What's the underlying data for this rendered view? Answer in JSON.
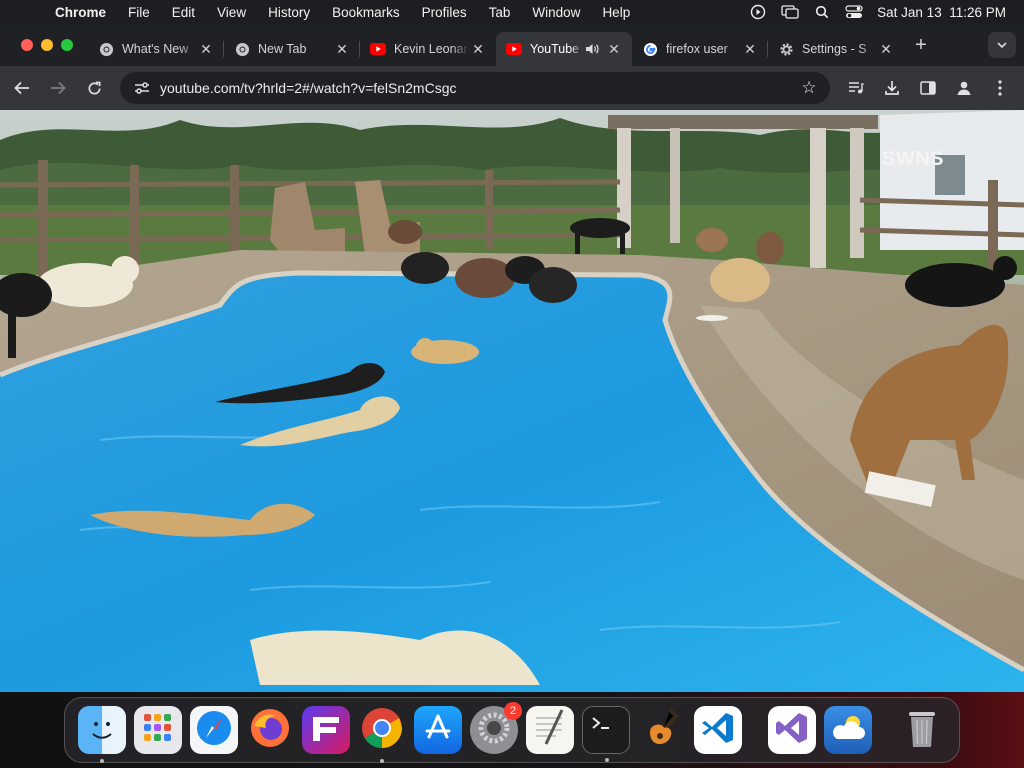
{
  "menubar": {
    "app": "Chrome",
    "items": [
      "File",
      "Edit",
      "View",
      "History",
      "Bookmarks",
      "Profiles",
      "Tab",
      "Window",
      "Help"
    ],
    "datetime": "Sat Jan 13  11:26 PM"
  },
  "tabs": [
    {
      "title": "What's New",
      "favicon": "chrome-icon",
      "active": false
    },
    {
      "title": "New Tab",
      "favicon": "chrome-icon",
      "active": false
    },
    {
      "title": "Kevin Leonard",
      "favicon": "youtube-icon",
      "active": false
    },
    {
      "title": "YouTube",
      "favicon": "youtube-icon",
      "active": true,
      "audio": true
    },
    {
      "title": "firefox user",
      "favicon": "google-icon",
      "active": false
    },
    {
      "title": "Settings - S",
      "favicon": "gear-icon",
      "active": false
    }
  ],
  "toolbar": {
    "url": "youtube.com/tv?hrld=2#/watch?v=felSn2mCsgc"
  },
  "video": {
    "watermark": "SWNS"
  },
  "dock": {
    "apps": [
      {
        "name": "Finder",
        "icon": "finder-icon",
        "running": true
      },
      {
        "name": "Launchpad",
        "icon": "launchpad-icon",
        "running": false
      },
      {
        "name": "Safari",
        "icon": "safari-icon",
        "running": false
      },
      {
        "name": "Firefox",
        "icon": "firefox-icon",
        "running": false
      },
      {
        "name": "Fenix",
        "icon": "fenix-icon",
        "running": false
      },
      {
        "name": "Chrome",
        "icon": "chrome-icon",
        "running": true
      },
      {
        "name": "App Store",
        "icon": "appstore-icon",
        "running": false
      },
      {
        "name": "System Settings",
        "icon": "settings-icon",
        "running": false,
        "badge": "2"
      },
      {
        "name": "TextEdit",
        "icon": "textedit-icon",
        "running": false
      },
      {
        "name": "Terminal",
        "icon": "terminal-icon",
        "running": true
      },
      {
        "name": "GarageBand",
        "icon": "garageband-icon",
        "running": false
      },
      {
        "name": "Visual Studio Code",
        "icon": "vscode-icon",
        "running": false
      },
      {
        "name": "Visual Studio",
        "icon": "visualstudio-icon",
        "running": false
      },
      {
        "name": "Weather",
        "icon": "weather-icon",
        "running": false
      },
      {
        "name": "Trash",
        "icon": "trash-icon",
        "running": false
      }
    ]
  },
  "colors": {
    "pool_water": "#2aa9e6",
    "deck": "#a89a86",
    "youtube_red": "#ff0000",
    "close": "#ff5f57",
    "minimize": "#febc2e",
    "zoom": "#28c840"
  }
}
